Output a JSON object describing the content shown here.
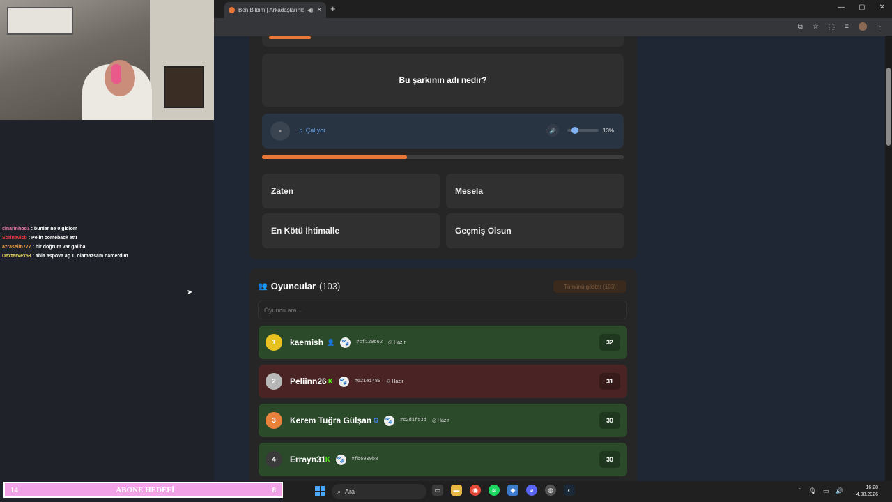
{
  "browser": {
    "tab_title": "Ben Bildim | Arkadaşlarınla",
    "tab_close": "✕",
    "new_tab": "+",
    "window_controls": [
      "—",
      "▢",
      "✕"
    ]
  },
  "quiz": {
    "question": "Bu şarkının adı nedir?",
    "player": {
      "status": "Çalıyor",
      "pause_icon": "⏸",
      "volume_icon": "🔊",
      "volume_label": "13%",
      "volume_fraction": 0.13
    },
    "progress_fraction": 0.4,
    "answers": [
      "Zaten",
      "Mesela",
      "En Kötü İhtimalle",
      "Geçmiş Olsun"
    ]
  },
  "players": {
    "title": "Oyuncular",
    "count": "(103)",
    "show_all": "Tümünü göster (103)",
    "search_placeholder": "Oyuncu ara...",
    "list": [
      {
        "rank": "1",
        "name": "kaemish",
        "badge": "👤",
        "hash": "#cf120d62",
        "ready": "Hazır",
        "score": "32",
        "row_color": "#2a4a2a",
        "rank_color": "#e8c020"
      },
      {
        "rank": "2",
        "name": "Peliinn26",
        "badge": "K",
        "hash": "#621e1480",
        "ready": "Hazır",
        "score": "31",
        "row_color": "#4a2424",
        "rank_color": "#b8b8b8"
      },
      {
        "rank": "3",
        "name": "Kerem Tuğra Gülşan",
        "badge": "G",
        "hash": "#c2d1f53d",
        "ready": "Hazır",
        "score": "30",
        "row_color": "#2a4a2a",
        "rank_color": "#e8823a"
      },
      {
        "rank": "4",
        "name": "Errayn31",
        "badge": "K",
        "hash": "#fb6909b8",
        "ready": "",
        "score": "30",
        "row_color": "#2a4a2a",
        "rank_color": "#3a3a3a"
      }
    ]
  },
  "chat": [
    {
      "user": "cinarinhoo1",
      "msg": "bunlar ne 0 gidiom"
    },
    {
      "user": "Sorinavicb",
      "msg": "Pelin comeback attı"
    },
    {
      "user": "azraselin777",
      "msg": "bir doğrum var galiba"
    },
    {
      "user": "DexterVex53",
      "msg": "abla aspova aç 1. olamazsam namerdim"
    }
  ],
  "goal": {
    "left": "14",
    "label": "ABONE HEDEFİ",
    "right": "8"
  },
  "taskbar": {
    "search_label": "Ara",
    "time": "16:28",
    "date": "4.08.2026"
  }
}
